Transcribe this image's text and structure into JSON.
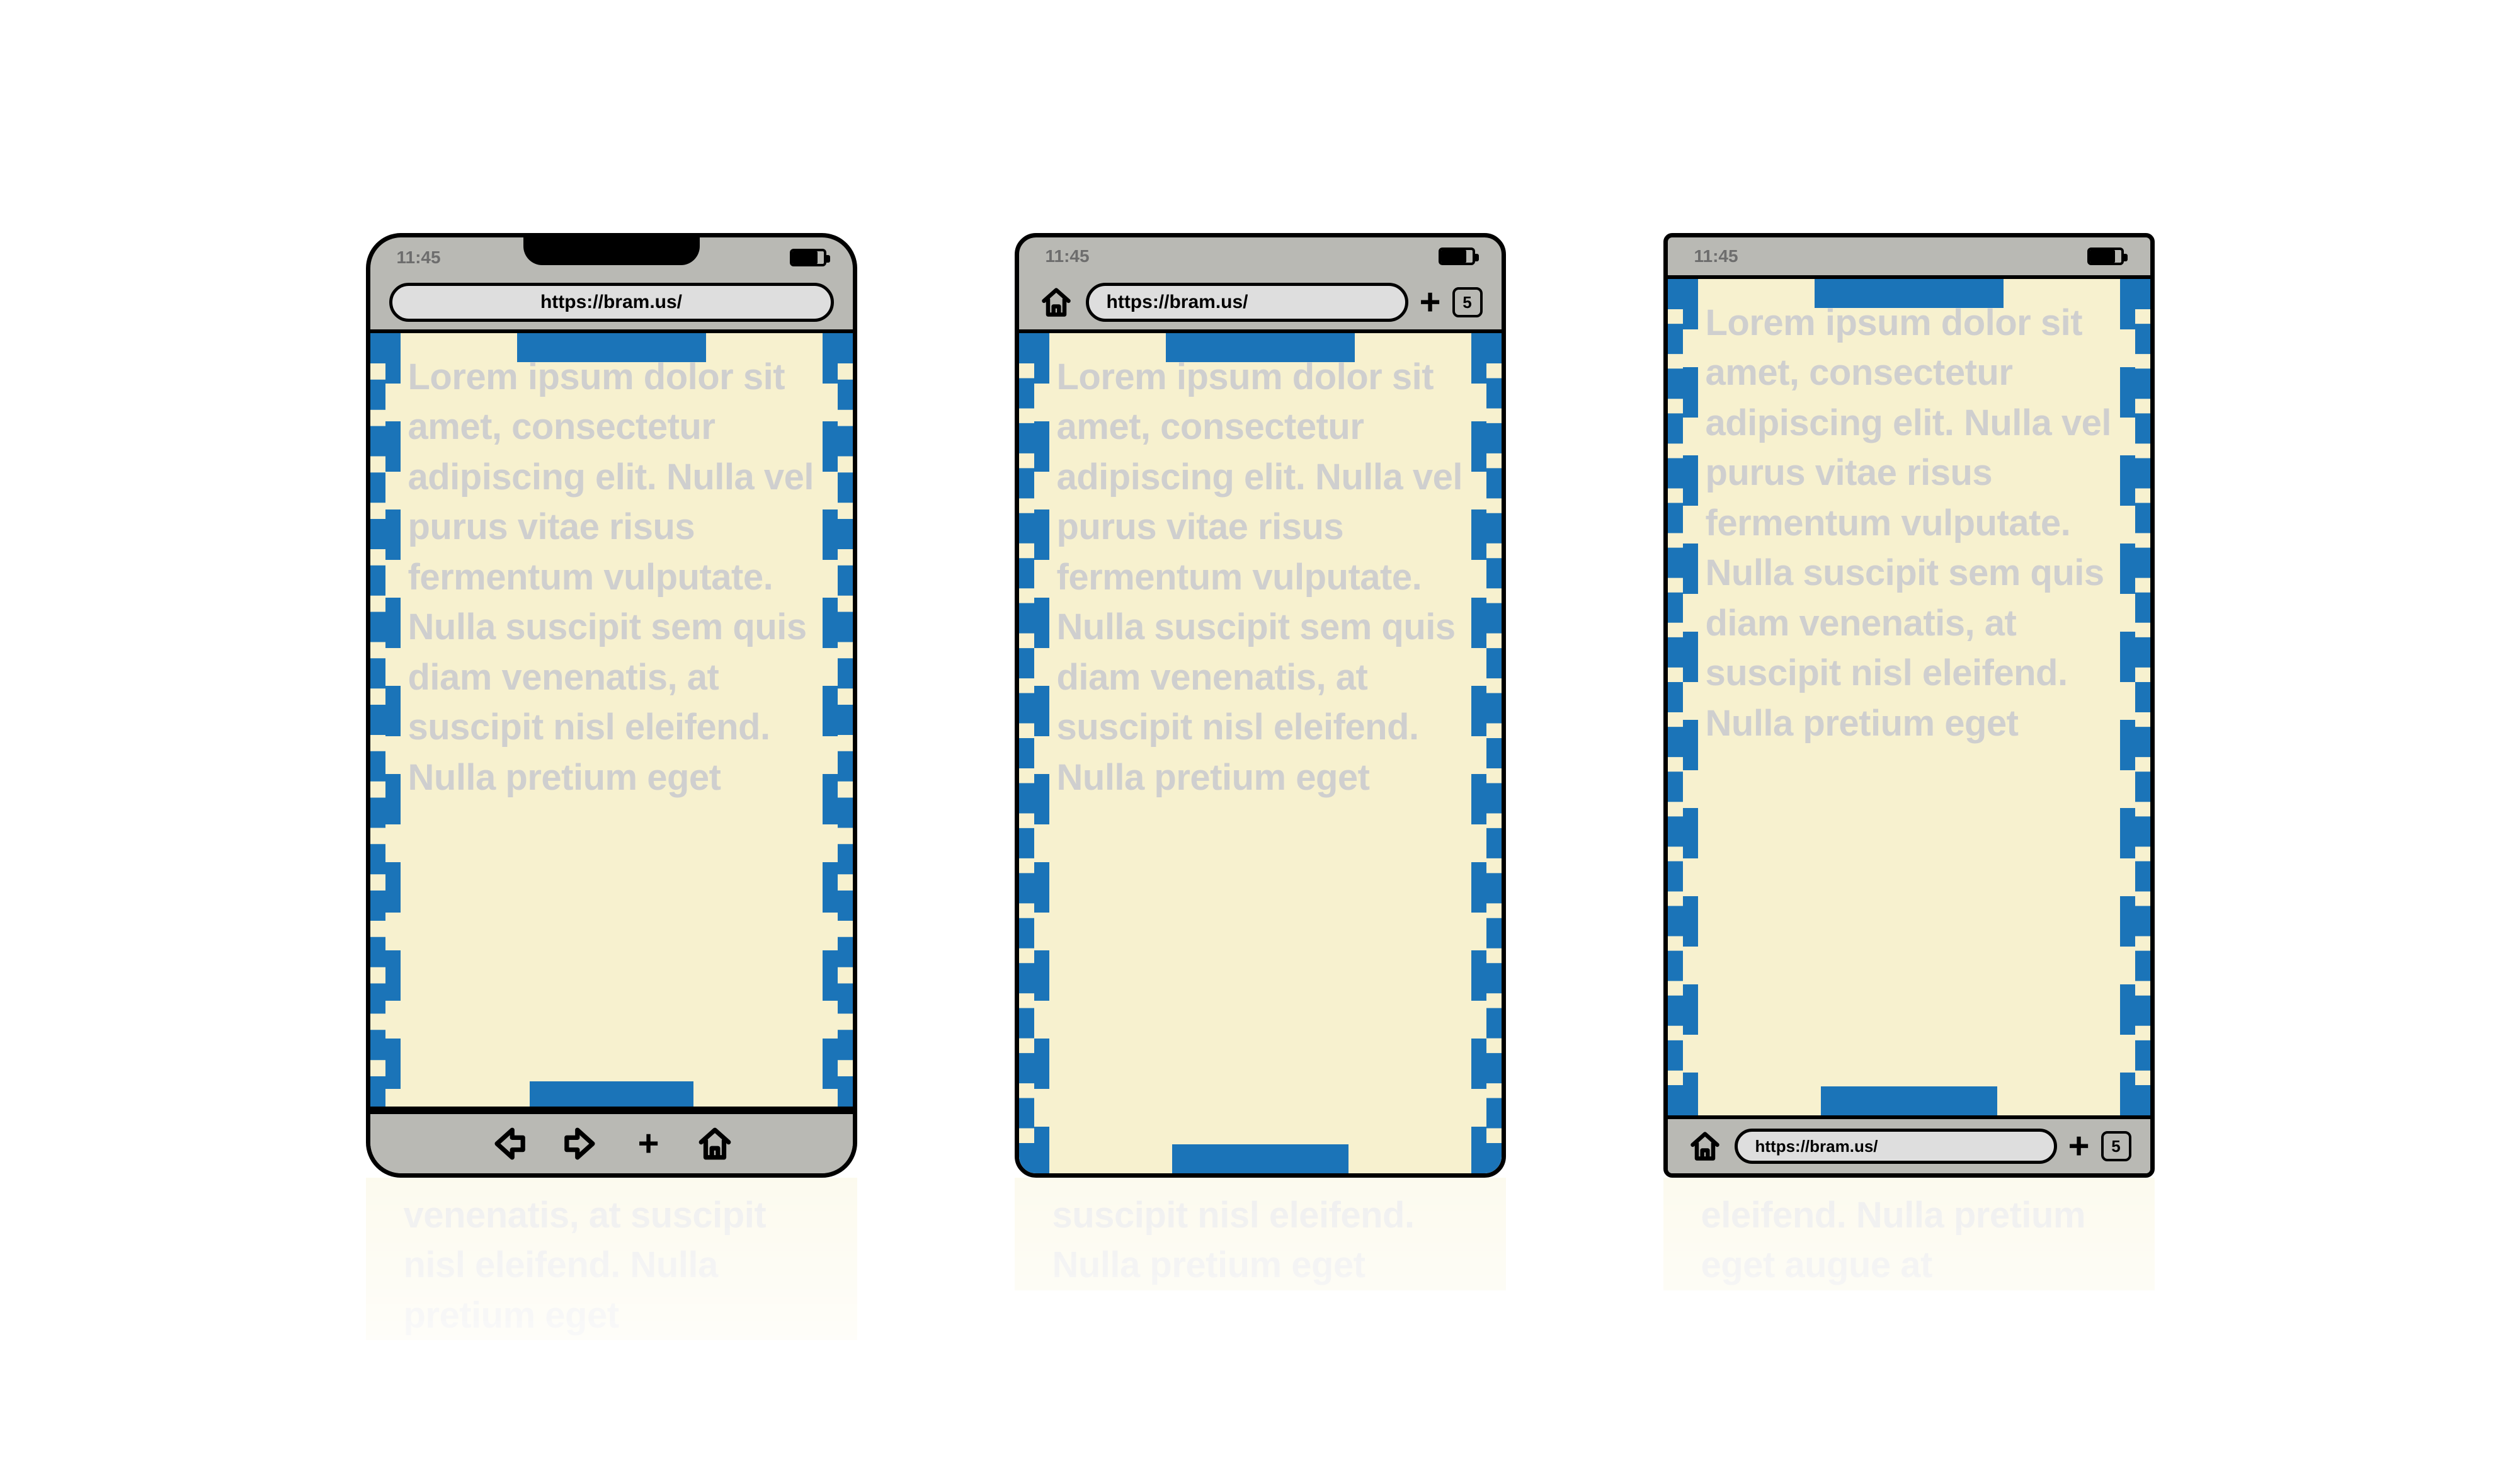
{
  "status_time": "11:45",
  "url": "https://bram.us/",
  "tab_count": "5",
  "lorem": "Lorem ipsum dolor sit amet, consectetur adipiscing elit. Nulla vel purus vitae risus fermentum vulputate. Nulla suscipit sem quis diam venenatis, at suscipit nisl eleifend. Nulla pretium eget",
  "reflection_text": "venenatis, at suscipit nisl eleifend. Nulla pretium eget",
  "reflection_text_b": "suscipit nisl eleifend. Nulla pretium eget",
  "reflection_text_c": "eleifend. Nulla pretium eget augue at"
}
